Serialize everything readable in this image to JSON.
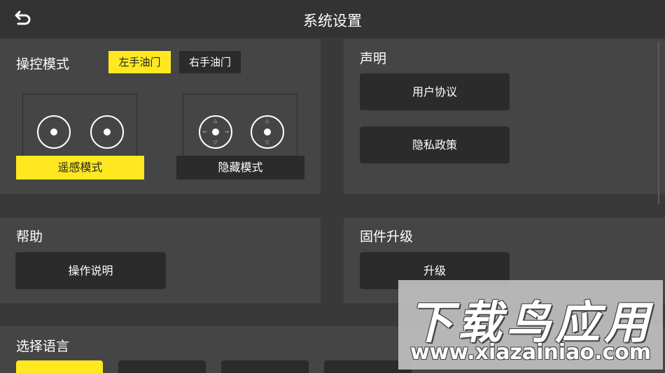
{
  "header": {
    "title": "系统设置",
    "back_icon": "back-arrow-icon"
  },
  "control_mode": {
    "title": "操控模式",
    "left_throttle": "左手油门",
    "right_throttle": "右手油门",
    "selected_throttle": "左手油门",
    "modes": [
      {
        "label": "遥感模式",
        "active": true
      },
      {
        "label": "隐藏模式",
        "active": false
      }
    ],
    "arrow_marks": [
      "←",
      "→",
      "△",
      "▽"
    ]
  },
  "statement": {
    "title": "声明",
    "user_agreement": "用户协议",
    "privacy_policy": "隐私政策"
  },
  "help": {
    "title": "帮助",
    "instructions": "操作说明"
  },
  "firmware": {
    "title": "固件升级",
    "upgrade": "升级"
  },
  "language": {
    "title": "选择语言"
  },
  "watermark": {
    "main": "下载鸟应用",
    "url": "www.xiazainiao.com"
  },
  "colors": {
    "accent": "#ffe81f",
    "background": "#393939",
    "panel": "#454545",
    "button": "#2b2b2b"
  }
}
